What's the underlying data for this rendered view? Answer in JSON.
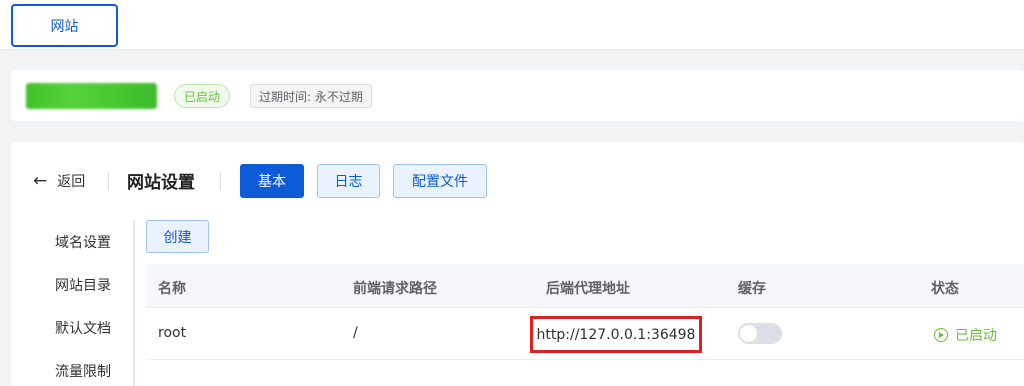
{
  "topbar": {
    "tab_label": "网站"
  },
  "info": {
    "status_label": "已启动",
    "expire_label": "过期时间: 永不过期"
  },
  "panel": {
    "back_label": "返回",
    "title": "网站设置",
    "tabs": [
      {
        "label": "基本",
        "active": true
      },
      {
        "label": "日志",
        "active": false
      },
      {
        "label": "配置文件",
        "active": false
      }
    ]
  },
  "sidebar": {
    "items": [
      {
        "label": "域名设置"
      },
      {
        "label": "网站目录"
      },
      {
        "label": "默认文档"
      },
      {
        "label": "流量限制"
      }
    ]
  },
  "proxy": {
    "create_label": "创建",
    "columns": [
      "名称",
      "前端请求路径",
      "后端代理地址",
      "缓存",
      "状态"
    ],
    "rows": [
      {
        "name": "root",
        "path": "/",
        "backend": "http://127.0.0.1:36498",
        "cache": false,
        "status": "已启动"
      }
    ]
  },
  "colors": {
    "primary": "#0d5bd6",
    "success": "#67c23a",
    "highlight": "#e02020"
  }
}
